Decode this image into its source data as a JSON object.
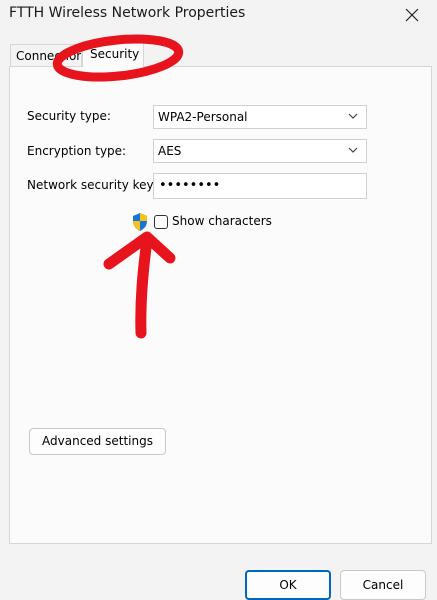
{
  "window": {
    "title": "FTTH Wireless Network Properties"
  },
  "tabs": [
    {
      "label": "Connection",
      "selected": false
    },
    {
      "label": "Security",
      "selected": true
    }
  ],
  "security": {
    "type_label": "Security type:",
    "type_value": "WPA2-Personal",
    "encryption_label": "Encryption type:",
    "encryption_value": "AES",
    "key_label": "Network security key",
    "key_value": "••••••••",
    "show_characters_label": "Show characters",
    "show_characters_checked": false
  },
  "buttons": {
    "advanced": "Advanced settings",
    "ok": "OK",
    "cancel": "Cancel"
  },
  "colors": {
    "annotation": "#e8141d",
    "ok_border": "#0067c0"
  },
  "icons": [
    "close-icon",
    "chevron-down-icon",
    "uac-shield-icon"
  ]
}
